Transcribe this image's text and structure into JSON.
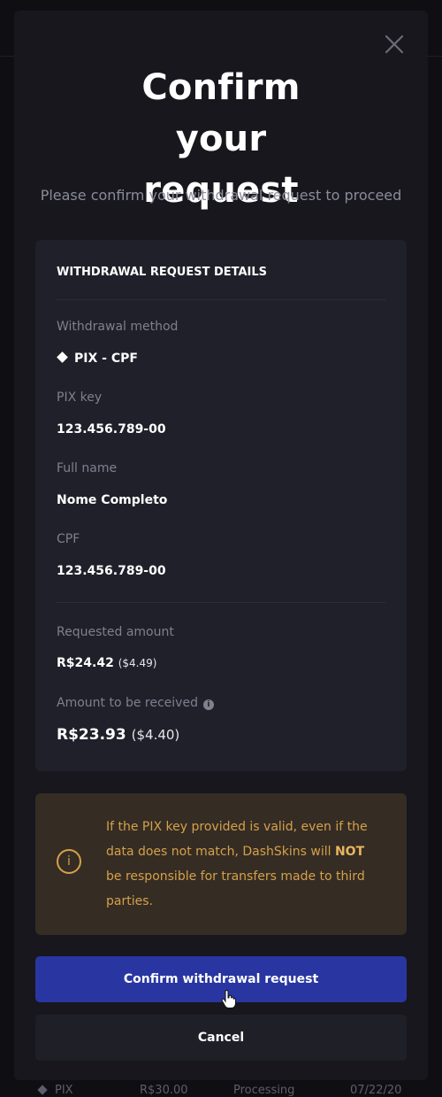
{
  "background_row": {
    "method": "PIX",
    "amount": "R$30.00",
    "status": "Processing",
    "date": "07/22/20"
  },
  "modal": {
    "title": "Confirm your request",
    "subtitle": "Please confirm your withdrawal request to proceed",
    "details": {
      "heading": "WITHDRAWAL REQUEST DETAILS",
      "method_label": "Withdrawal method",
      "method_value": "PIX - CPF",
      "pix_key_label": "PIX key",
      "pix_key_value": "123.456.789-00",
      "full_name_label": "Full name",
      "full_name_value": "Nome Completo",
      "cpf_label": "CPF",
      "cpf_value": "123.456.789-00",
      "requested_label": "Requested amount",
      "requested_value": "R$24.42",
      "requested_usd": "($4.49)",
      "received_label": "Amount to be received",
      "received_value": "R$23.93",
      "received_usd": "($4.40)"
    },
    "warning": {
      "icon_glyph": "i",
      "text_before": "If the PIX key provided is valid, even if the data does not match, DashSkins will ",
      "text_bold": "NOT",
      "text_after": " be responsible for transfers made to third parties."
    },
    "confirm_label": "Confirm withdrawal request",
    "cancel_label": "Cancel"
  },
  "icons": {
    "close": "close-icon",
    "pix": "pix-diamond-icon",
    "info": "info-icon",
    "warning": "info-circle-icon",
    "cursor": "hand-pointer-cursor"
  },
  "colors": {
    "accent": "#2936a2",
    "warning_text": "#d4a14a",
    "warning_bg": "#352c24",
    "panel_bg": "#1f2029",
    "modal_bg": "#17171d"
  }
}
